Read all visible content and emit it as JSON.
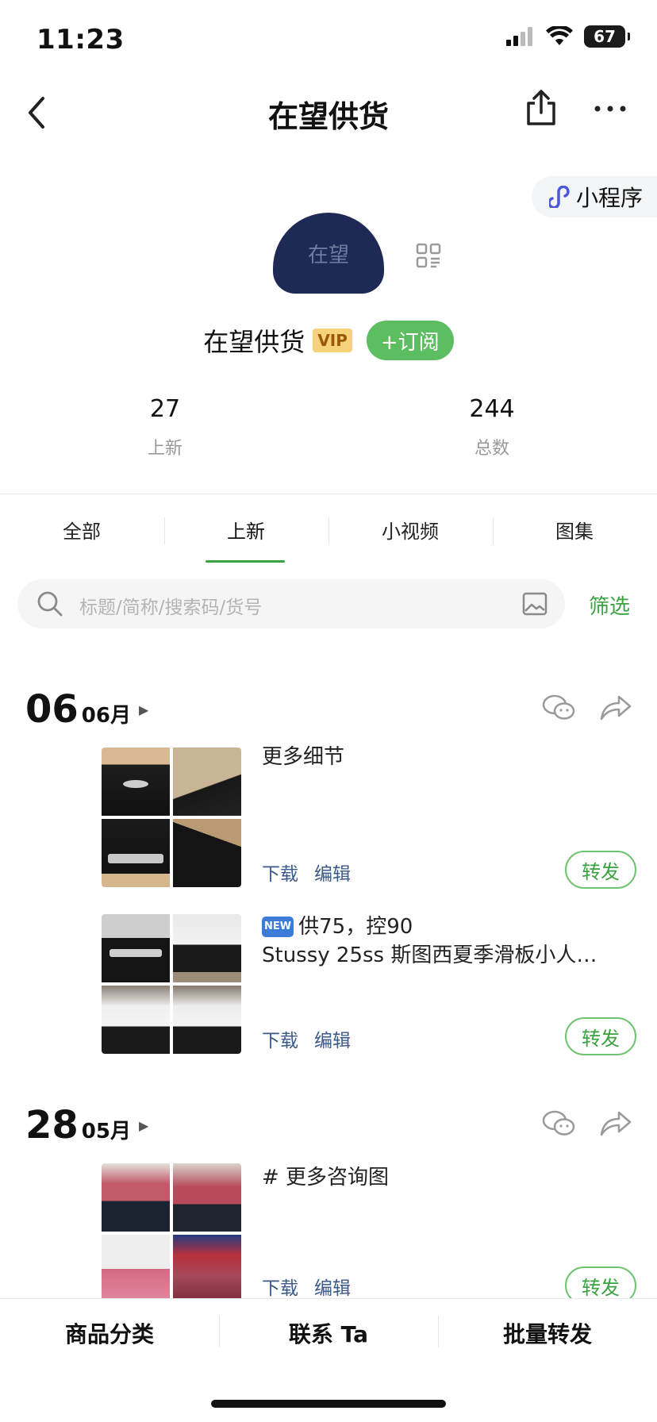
{
  "status": {
    "time": "11:23",
    "battery": "67"
  },
  "nav": {
    "title": "在望供货"
  },
  "mini_program": {
    "label": "小程序"
  },
  "profile": {
    "avatar_text": "在望",
    "name": "在望供货",
    "vip": "VIP",
    "subscribe": "+订阅"
  },
  "stats": [
    {
      "value": "27",
      "label": "上新"
    },
    {
      "value": "244",
      "label": "总数"
    }
  ],
  "tabs": [
    {
      "label": "全部"
    },
    {
      "label": "上新"
    },
    {
      "label": "小视频"
    },
    {
      "label": "图集"
    }
  ],
  "search": {
    "placeholder": "标题/简称/搜索码/货号",
    "filter": "筛选"
  },
  "groups": [
    {
      "day": "06",
      "month": "06月",
      "posts": [
        {
          "text": "更多细节",
          "download": "下载",
          "edit": "编辑",
          "forward": "转发"
        },
        {
          "badge": "NEW",
          "text": "供75，控90",
          "text2": "Stussy 25ss 斯图西夏季滑板小人…",
          "download": "下载",
          "edit": "编辑",
          "forward": "转发"
        }
      ]
    },
    {
      "day": "28",
      "month": "05月",
      "posts": [
        {
          "text": "# 更多咨询图",
          "download": "下载",
          "edit": "编辑",
          "forward": "转发"
        }
      ]
    }
  ],
  "bottom": [
    {
      "label": "商品分类"
    },
    {
      "label": "联系 Ta"
    },
    {
      "label": "批量转发"
    }
  ],
  "colors": {
    "accent": "#3aa33f",
    "link": "#3b5a8a",
    "subscribe": "#5dbd61",
    "vip": "#f6d37a"
  }
}
